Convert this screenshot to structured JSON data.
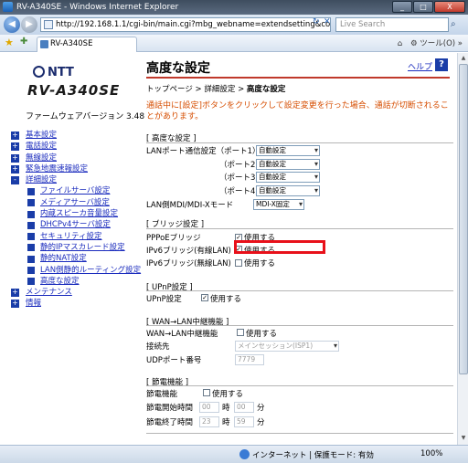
{
  "window": {
    "title": "RV-A340SE - Windows Internet Explorer",
    "buttons": [
      "_",
      "□",
      "X"
    ]
  },
  "address": {
    "url": "http://192.168.1.1/cgi-bin/main.cgi?mbg_webname=extendsetting&confi",
    "search_placeholder": "Live Search"
  },
  "tab": {
    "label": "RV-A340SE",
    "tools": "ツール(O)"
  },
  "sidebar": {
    "brand": "NTT",
    "model": "RV-A340SE",
    "firmware": "ファームウェアバージョン 3.48",
    "items": [
      {
        "label": "基本設定",
        "box": "+"
      },
      {
        "label": "電話設定",
        "box": "+"
      },
      {
        "label": "無線設定",
        "box": "+"
      },
      {
        "label": "緊急地震速報設定",
        "box": "+"
      },
      {
        "label": "詳細設定",
        "box": "-"
      }
    ],
    "subitems": [
      "ファイルサーバ設定",
      "メディアサーバ設定",
      "内蔵スピーカ音量設定",
      "DHCPv4サーバ設定",
      "セキュリティ設定",
      "静的IPマスカレード設定",
      "静的NAT設定",
      "LAN側静的ルーティング設定",
      "高度な設定"
    ],
    "items_after": [
      {
        "label": "メンテナンス",
        "box": "+"
      },
      {
        "label": "情報",
        "box": "+"
      }
    ]
  },
  "main": {
    "title": "高度な設定",
    "help": "ヘルプ",
    "breadcrumb": {
      "home": "トップページ",
      "sep": " > ",
      "parent": "詳細設定",
      "current": "高度な設定"
    },
    "notice": "通話中に[設定]ボタンをクリックして設定変更を行った場合、通話が切断されることがあります。",
    "advanced": {
      "header": "[ 高度な設定 ]",
      "lan_port_label": "LANポート通信設定（ポート1）",
      "ports": [
        {
          "label": "LANポート通信設定（ポート1）",
          "value": "自動設定"
        },
        {
          "label": "（ポート2）",
          "value": "自動設定"
        },
        {
          "label": "（ポート3）",
          "value": "自動設定"
        },
        {
          "label": "（ポート4）",
          "value": "自動設定"
        }
      ],
      "mdi_label": "LAN側MDI/MDI-Xモード",
      "mdi_value": "MDI-X固定"
    },
    "bridge": {
      "header": "[ ブリッジ設定 ]",
      "rows": [
        {
          "label": "PPPoEブリッジ",
          "check_label": "使用する",
          "checked": true
        },
        {
          "label": "IPv6ブリッジ(有線LAN)",
          "check_label": "使用する",
          "checked": true
        },
        {
          "label": "IPv6ブリッジ(無線LAN)",
          "check_label": "使用する",
          "checked": false
        }
      ]
    },
    "upnp": {
      "header": "[ UPnP設定 ]",
      "label": "UPnP設定",
      "check_label": "使用する",
      "checked": true
    },
    "wan_relay": {
      "header": "[ WAN→LAN中継機能 ]",
      "label": "WAN→LAN中継機能",
      "check_label": "使用する",
      "checked": false,
      "dest_label": "接続先",
      "dest_value": "メインセッション(ISP1)",
      "udp_label": "UDPポート番号",
      "udp_value": "7779"
    },
    "power_saving": {
      "header": "[ 節電機能 ]",
      "label": "節電機能",
      "check_label": "使用する",
      "checked": false,
      "start_label": "節電開始時間",
      "start_hour": "00",
      "start_min": "00",
      "end_label": "節電終了時間",
      "end_hour": "23",
      "end_min": "59",
      "hour_unit": "時",
      "min_unit": "分"
    }
  },
  "status": {
    "zone": "インターネット | 保護モード: 有効",
    "zoom": "100%"
  },
  "colors": {
    "accent_red": "#e8101a",
    "link_blue": "#1a2bbd",
    "notice_orange": "#d64d00"
  }
}
